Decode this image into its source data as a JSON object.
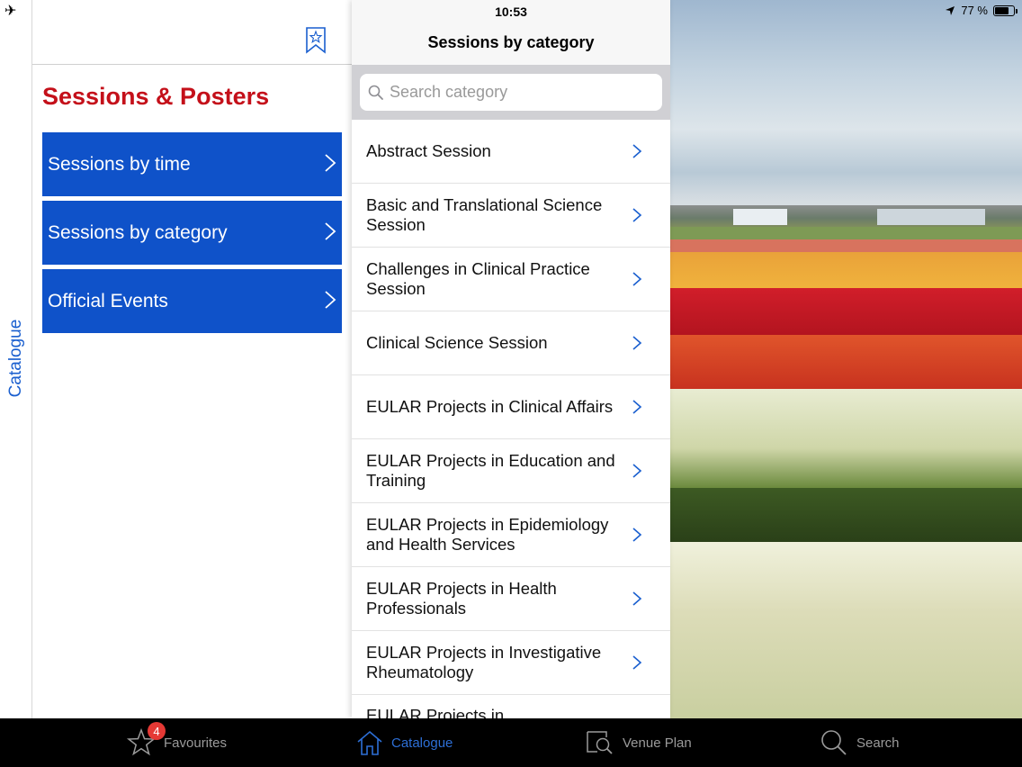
{
  "status_bar": {
    "time": "10:53",
    "battery_text": "77 %",
    "battery_level": 0.77
  },
  "rail": {
    "label": "Catalogue"
  },
  "left_panel": {
    "title": "Sessions & Posters",
    "items": [
      {
        "label": "Sessions by time"
      },
      {
        "label": "Sessions by category"
      },
      {
        "label": "Official Events"
      }
    ]
  },
  "mid_panel": {
    "title": "Sessions by category",
    "search": {
      "placeholder": "Search category",
      "value": ""
    },
    "items": [
      {
        "label": "Abstract Session"
      },
      {
        "label": "Basic and Translational Science Session"
      },
      {
        "label": "Challenges in Clinical Practice Session"
      },
      {
        "label": "Clinical Science Session"
      },
      {
        "label": "EULAR Projects in Clinical Affairs"
      },
      {
        "label": "EULAR Projects in Education and Training"
      },
      {
        "label": "EULAR Projects in Epidemiology and Health Services"
      },
      {
        "label": "EULAR Projects in Health Professionals"
      },
      {
        "label": "EULAR Projects in Investigative Rheumatology"
      },
      {
        "label": "EULAR Projects in"
      }
    ]
  },
  "tabbar": {
    "favourites": {
      "label": "Favourites",
      "badge": "4"
    },
    "catalogue": {
      "label": "Catalogue"
    },
    "venue_plan": {
      "label": "Venue Plan"
    },
    "search": {
      "label": "Search"
    }
  },
  "colors": {
    "accent_blue": "#0f52c9",
    "title_red": "#c4101a",
    "active_tab": "#2d6fd6",
    "badge_red": "#e53935"
  }
}
